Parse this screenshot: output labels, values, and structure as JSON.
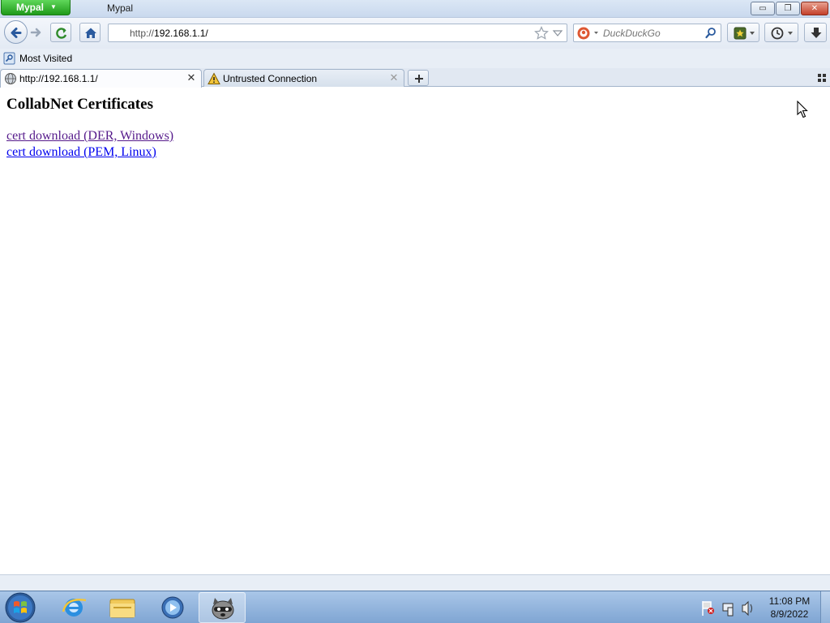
{
  "window": {
    "app_menu_label": "Mypal",
    "title": "Mypal",
    "minimize_glyph": "▭",
    "maximize_glyph": "❐",
    "close_glyph": "✕"
  },
  "toolbar": {
    "url_scheme": "http://",
    "url_host": "192.168.1.1/",
    "search_placeholder": "DuckDuckGo"
  },
  "bookmarks": {
    "items": [
      {
        "label": "Most Visited",
        "icon": "bookmark-folder-icon"
      }
    ]
  },
  "tabs": [
    {
      "title": "http://192.168.1.1/",
      "active": true,
      "icon": "globe-icon",
      "close_glyph": "✕"
    },
    {
      "title": "Untrusted Connection",
      "active": false,
      "icon": "warning-icon",
      "close_glyph": "✕"
    }
  ],
  "page": {
    "heading": "CollabNet Certificates",
    "links": [
      {
        "label": "cert download (DER, Windows)",
        "visited": true
      },
      {
        "label": "cert download (PEM, Linux)",
        "visited": false
      }
    ]
  },
  "taskbar": {
    "apps": [
      "internet-explorer",
      "windows-explorer",
      "media-player",
      "mypal"
    ],
    "clock_time": "11:08 PM",
    "clock_date": "8/9/2022"
  },
  "colors": {
    "visited_link": "#551a8b",
    "unvisited_link": "#0000ee",
    "app_button": "#2eb82a"
  }
}
